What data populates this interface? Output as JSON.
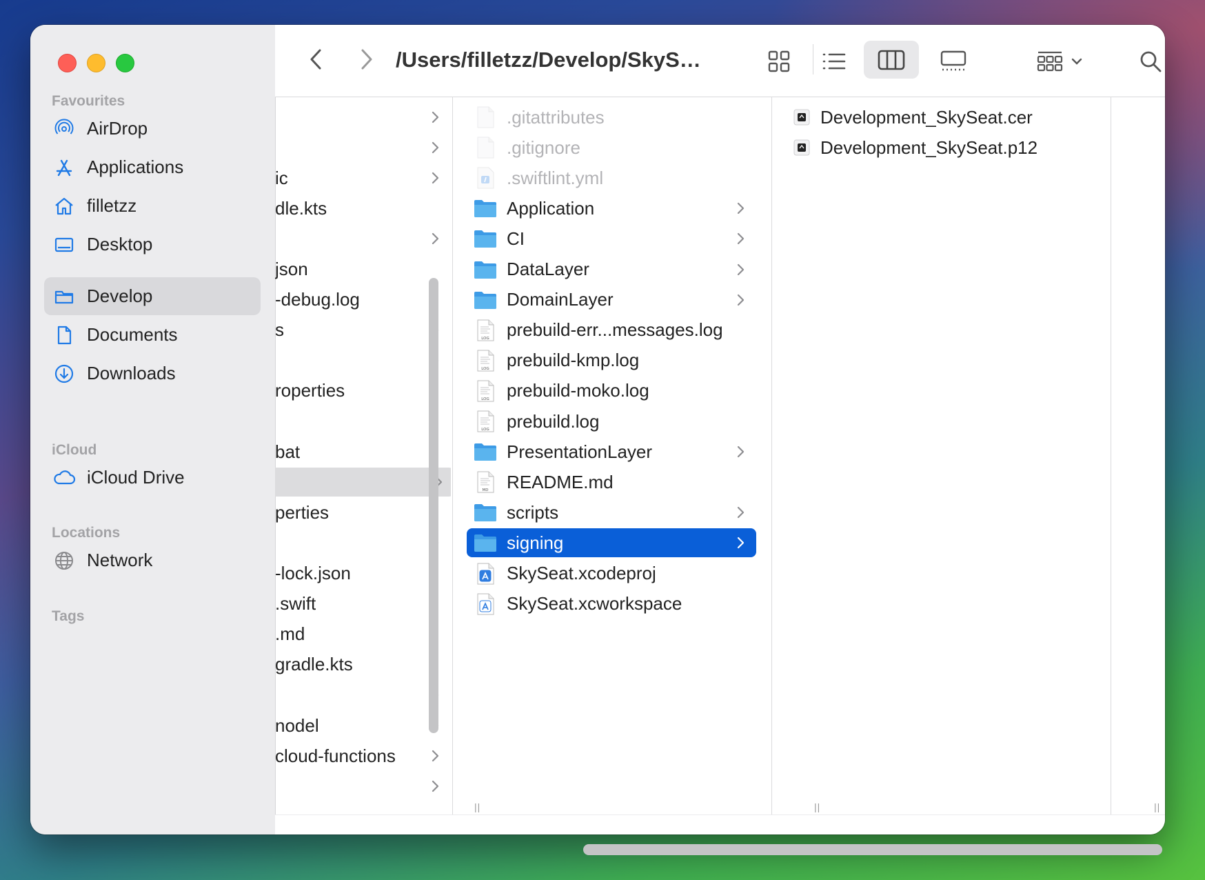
{
  "window": {
    "path_title": "/Users/filletzz/Develop/SkySe..."
  },
  "sidebar": {
    "sections": {
      "favourites": "Favourites",
      "icloud": "iCloud",
      "locations": "Locations",
      "tags": "Tags"
    },
    "favourites": [
      {
        "label": "AirDrop",
        "icon": "airdrop-icon"
      },
      {
        "label": "Applications",
        "icon": "applications-icon"
      },
      {
        "label": "filletzz",
        "icon": "home-icon"
      },
      {
        "label": "Desktop",
        "icon": "desktop-icon"
      },
      {
        "label": "Develop",
        "icon": "folder-icon",
        "selected": true
      },
      {
        "label": "Documents",
        "icon": "document-icon"
      },
      {
        "label": "Downloads",
        "icon": "downloads-icon"
      }
    ],
    "icloud": [
      {
        "label": "iCloud Drive",
        "icon": "cloud-icon"
      }
    ],
    "locations": [
      {
        "label": "Network",
        "icon": "globe-icon"
      }
    ]
  },
  "column1": {
    "rows": [
      {
        "text": "",
        "chevron": true
      },
      {
        "text": "",
        "chevron": true
      },
      {
        "text": "ic",
        "chevron": true
      },
      {
        "text": "dle.kts",
        "chevron": false
      },
      {
        "text": "",
        "chevron": true
      },
      {
        "text": "json",
        "chevron": false
      },
      {
        "text": "-debug.log",
        "chevron": false
      },
      {
        "text": "s",
        "chevron": true
      },
      {
        "text": "",
        "chevron": true
      },
      {
        "text": "roperties",
        "chevron": false
      },
      {
        "text": "",
        "chevron": false
      },
      {
        "text": "bat",
        "chevron": false
      },
      {
        "text": "",
        "chevron": true,
        "selected": true
      },
      {
        "text": "perties",
        "chevron": false
      },
      {
        "text": "",
        "chevron": true
      },
      {
        "text": "-lock.json",
        "chevron": false
      },
      {
        "text": ".swift",
        "chevron": false
      },
      {
        "text": ".md",
        "chevron": false
      },
      {
        "text": "gradle.kts",
        "chevron": false
      },
      {
        "text": "",
        "chevron": true
      },
      {
        "text": "nodel",
        "chevron": true
      },
      {
        "text": "cloud-functions",
        "chevron": true
      },
      {
        "text": "",
        "chevron": true
      }
    ]
  },
  "column2": {
    "rows": [
      {
        "name": ".gitattributes",
        "kind": "file",
        "hidden": true
      },
      {
        "name": ".gitignore",
        "kind": "file",
        "hidden": true
      },
      {
        "name": ".swiftlint.yml",
        "kind": "yml",
        "hidden": true
      },
      {
        "name": "Application",
        "kind": "folder"
      },
      {
        "name": "CI",
        "kind": "folder"
      },
      {
        "name": "DataLayer",
        "kind": "folder"
      },
      {
        "name": "DomainLayer",
        "kind": "folder"
      },
      {
        "name": "prebuild-err...messages.log",
        "kind": "log"
      },
      {
        "name": "prebuild-kmp.log",
        "kind": "log"
      },
      {
        "name": "prebuild-moko.log",
        "kind": "log"
      },
      {
        "name": "prebuild.log",
        "kind": "log"
      },
      {
        "name": "PresentationLayer",
        "kind": "folder"
      },
      {
        "name": "README.md",
        "kind": "md"
      },
      {
        "name": "scripts",
        "kind": "folder"
      },
      {
        "name": "signing",
        "kind": "folder",
        "selected": true
      },
      {
        "name": "SkySeat.xcodeproj",
        "kind": "xcodeproj"
      },
      {
        "name": "SkySeat.xcworkspace",
        "kind": "xcworkspace"
      }
    ],
    "log_badge": "LOG",
    "md_badge": "MD"
  },
  "column3": {
    "rows": [
      {
        "name": "Development_SkySeat.cer",
        "kind": "certificate"
      },
      {
        "name": "Development_SkySeat.p12",
        "kind": "certificate"
      }
    ]
  },
  "colors": {
    "accent": "#0a5fd8",
    "sidebar_icon": "#1f7ae6",
    "folder": "#5ab4ee"
  }
}
